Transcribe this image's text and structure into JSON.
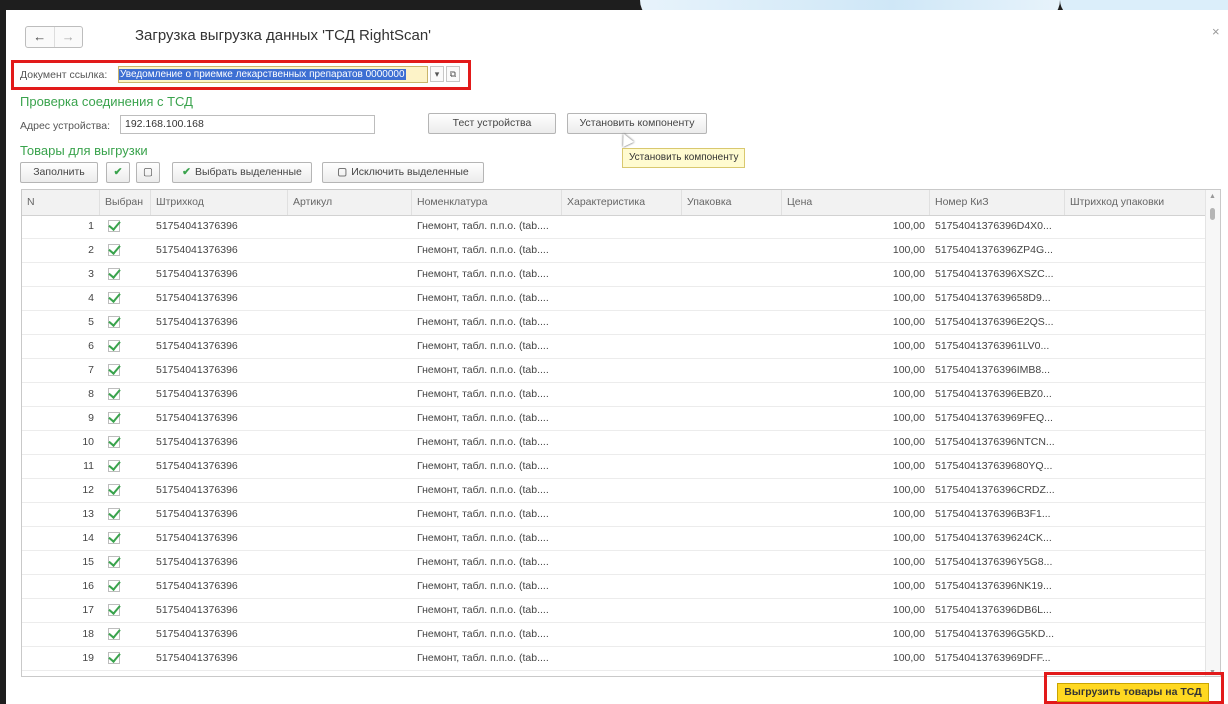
{
  "window": {
    "title": "Загрузка выгрузка данных 'ТСД RightScan'",
    "nav_back": "←",
    "nav_forward": "→",
    "close": "×"
  },
  "document": {
    "label": "Документ ссылка:",
    "value": "Уведомление о приемке лекарственных препаратов 0000000"
  },
  "connection": {
    "section_title": "Проверка соединения с ТСД",
    "address_label": "Адрес устройства:",
    "address_value": "192.168.100.168",
    "test_button": "Тест устройства",
    "install_button": "Установить компоненту",
    "tooltip": "Установить компоненту"
  },
  "goods": {
    "section_title": "Товары для выгрузки",
    "fill_button": "Заполнить",
    "select_button": "Выбрать выделенные",
    "exclude_button": "Исключить выделенные"
  },
  "table": {
    "columns": [
      "N",
      "Выбран",
      "Штрихкод",
      "Артикул",
      "Номенклатура",
      "Характеристика",
      "Упаковка",
      "Цена",
      "Номер КиЗ",
      "Штрихкод упаковки"
    ],
    "rows": [
      {
        "n": "1",
        "barcode": "51754041376396",
        "name": "Гнемонт, табл. п.п.о. (tab....",
        "price": "100,00",
        "kiz": "5175404137639­6D4X0..."
      },
      {
        "n": "2",
        "barcode": "51754041376396",
        "name": "Гнемонт, табл. п.п.о. (tab....",
        "price": "100,00",
        "kiz": "51754041376396ZP4G..."
      },
      {
        "n": "3",
        "barcode": "51754041376396",
        "name": "Гнемонт, табл. п.п.о. (tab....",
        "price": "100,00",
        "kiz": "51754041376396XSZC..."
      },
      {
        "n": "4",
        "barcode": "51754041376396",
        "name": "Гнемонт, табл. п.п.о. (tab....",
        "price": "100,00",
        "kiz": "51754041376396­58D9..."
      },
      {
        "n": "5",
        "barcode": "51754041376396",
        "name": "Гнемонт, табл. п.п.о. (tab....",
        "price": "100,00",
        "kiz": "51754041376396E2QS..."
      },
      {
        "n": "6",
        "barcode": "51754041376396",
        "name": "Гнемонт, табл. п.п.о. (tab....",
        "price": "100,00",
        "kiz": "51754041376396­1LV0..."
      },
      {
        "n": "7",
        "barcode": "51754041376396",
        "name": "Гнемонт, табл. п.п.о. (tab....",
        "price": "100,00",
        "kiz": "51754041376396IMB8..."
      },
      {
        "n": "8",
        "barcode": "51754041376396",
        "name": "Гнемонт, табл. п.п.о. (tab....",
        "price": "100,00",
        "kiz": "51754041376396EBZ0..."
      },
      {
        "n": "9",
        "barcode": "51754041376396",
        "name": "Гнемонт, табл. п.п.о. (tab....",
        "price": "100,00",
        "kiz": "51754041376396­9FEQ..."
      },
      {
        "n": "10",
        "barcode": "51754041376396",
        "name": "Гнемонт, табл. п.п.о. (tab....",
        "price": "100,00",
        "kiz": "51754041376396NTCN..."
      },
      {
        "n": "11",
        "barcode": "51754041376396",
        "name": "Гнемонт, табл. п.п.о. (tab....",
        "price": "100,00",
        "kiz": "51754041376396­80YQ..."
      },
      {
        "n": "12",
        "barcode": "51754041376396",
        "name": "Гнемонт, табл. п.п.о. (tab....",
        "price": "100,00",
        "kiz": "51754041376396CRDZ..."
      },
      {
        "n": "13",
        "barcode": "51754041376396",
        "name": "Гнемонт, табл. п.п.о. (tab....",
        "price": "100,00",
        "kiz": "51754041376396B3F1..."
      },
      {
        "n": "14",
        "barcode": "51754041376396",
        "name": "Гнемонт, табл. п.п.о. (tab....",
        "price": "100,00",
        "kiz": "51754041376396­24CK..."
      },
      {
        "n": "15",
        "barcode": "51754041376396",
        "name": "Гнемонт, табл. п.п.о. (tab....",
        "price": "100,00",
        "kiz": "51754041376396Y5G8..."
      },
      {
        "n": "16",
        "barcode": "51754041376396",
        "name": "Гнемонт, табл. п.п.о. (tab....",
        "price": "100,00",
        "kiz": "51754041376396NK19..."
      },
      {
        "n": "17",
        "barcode": "51754041376396",
        "name": "Гнемонт, табл. п.п.о. (tab....",
        "price": "100,00",
        "kiz": "51754041376396DB6L..."
      },
      {
        "n": "18",
        "barcode": "51754041376396",
        "name": "Гнемонт, табл. п.п.о. (tab....",
        "price": "100,00",
        "kiz": "51754041376396G5KD..."
      },
      {
        "n": "19",
        "barcode": "51754041376396",
        "name": "Гнемонт, табл. п.п.о. (tab....",
        "price": "100,00",
        "kiz": "51754041376396­9DFF..."
      }
    ]
  },
  "footer": {
    "export_button": "Выгрузить товары на ТСД"
  },
  "colors": {
    "accent_green": "#3aa34d",
    "highlight_red": "#e21a1a",
    "export_yellow": "#ffd821",
    "selection_blue": "#3d6fd3"
  }
}
